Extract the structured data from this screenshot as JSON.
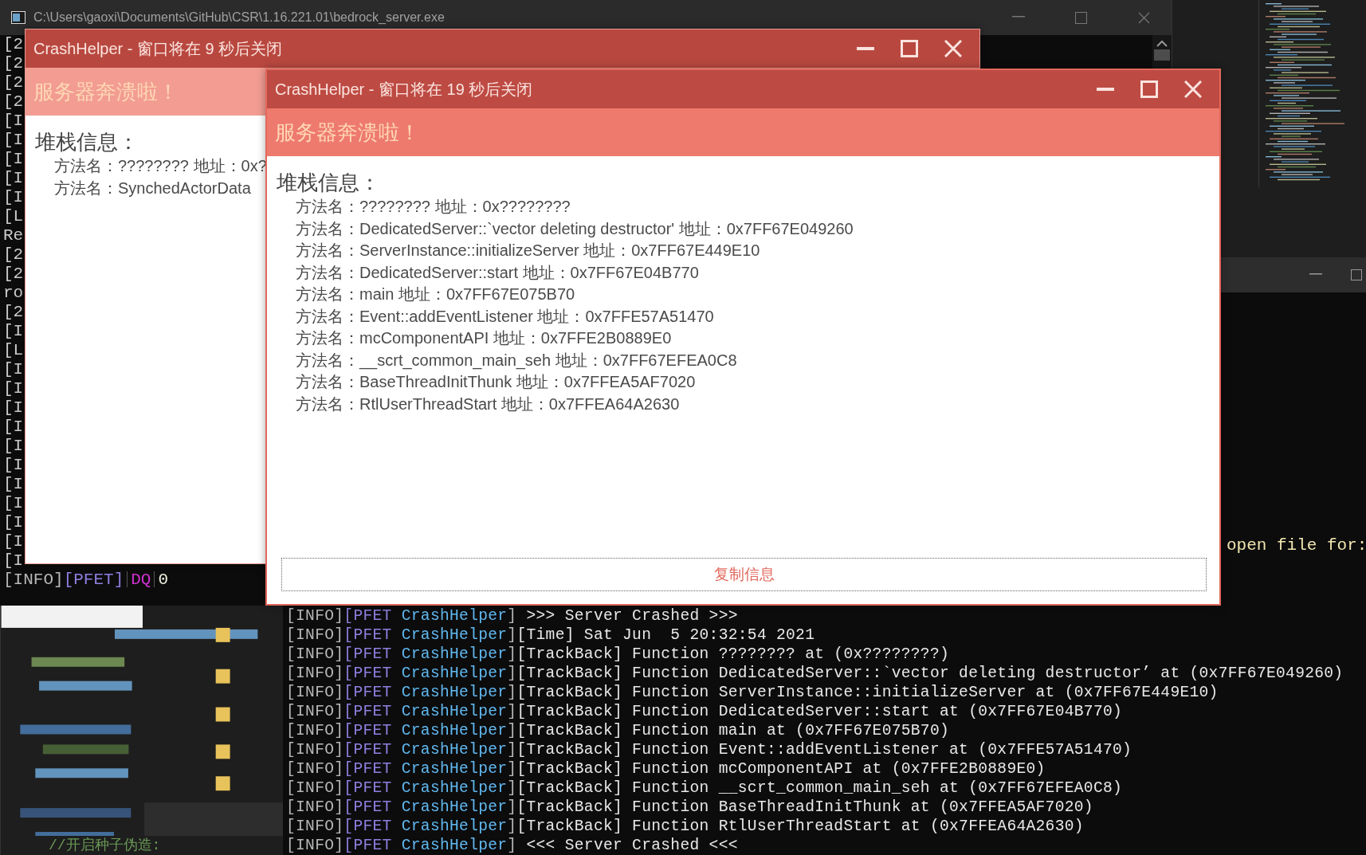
{
  "console_window": {
    "title": "C:\\Users\\gaoxi\\Documents\\GitHub\\CSR\\1.16.221.01\\bedrock_server.exe",
    "lines": [
      "[2",
      "[2",
      "[2",
      "[2",
      "[I",
      "[I",
      "[I",
      "[I",
      "[I",
      "[L",
      "Re",
      "[2",
      "[2",
      "ro",
      "[2",
      "[I",
      "[L",
      "[I",
      "[I",
      "[I",
      "[I",
      "[I",
      "[I",
      "[I",
      "[I",
      "[I",
      "[I",
      "[I"
    ],
    "status_line": {
      "level": "[INFO]",
      "module": "[PFET]",
      "tag": "DQ",
      "value": "0"
    }
  },
  "crash_windows": [
    {
      "title": "CrashHelper - 窗口将在 9 秒后关闭",
      "active": false,
      "header": "服务器奔溃啦！",
      "section_title": "堆栈信息：",
      "frames": [
        "方法名：???????? 地址：0x?",
        "方法名：SynchedActorData"
      ]
    },
    {
      "title": "CrashHelper - 窗口将在 19 秒后关闭",
      "active": true,
      "header": "服务器奔溃啦！",
      "section_title": "堆栈信息：",
      "frames": [
        "方法名：???????? 地址：0x????????",
        "方法名：DedicatedServer::`vector deleting destructor' 地址：0x7FF67E049260",
        "方法名：ServerInstance::initializeServer 地址：0x7FF67E449E10",
        "方法名：DedicatedServer::start 地址：0x7FF67E04B770",
        "方法名：main 地址：0x7FF67E075B70",
        "方法名：Event::addEventListener 地址：0x7FFE57A51470",
        "方法名：mcComponentAPI 地址：0x7FFE2B0889E0",
        "方法名：__scrt_common_main_seh 地址：0x7FF67EFEA0C8",
        "方法名：BaseThreadInitThunk 地址：0x7FFEA5AF7020",
        "方法名：RtlUserThreadStart 地址：0x7FFEA64A2630"
      ],
      "copy_button": "复制信息"
    }
  ],
  "log_console": {
    "partial_line": "open file for:",
    "lines": [
      {
        "level": "[INFO]",
        "module": "[PFET",
        "source": "CrashHelper",
        "close": "]",
        "message": " >>> Server Crashed >>>"
      },
      {
        "level": "[INFO]",
        "module": "[PFET",
        "source": "CrashHelper",
        "close": "]",
        "message": "[Time] Sat Jun  5 20:32:54 2021"
      },
      {
        "level": "[INFO]",
        "module": "[PFET",
        "source": "CrashHelper",
        "close": "]",
        "message": "[TrackBack] Function ???????? at (0x????????)"
      },
      {
        "level": "[INFO]",
        "module": "[PFET",
        "source": "CrashHelper",
        "close": "]",
        "message": "[TrackBack] Function DedicatedServer::`vector deleting destructor’ at (0x7FF67E049260)"
      },
      {
        "level": "[INFO]",
        "module": "[PFET",
        "source": "CrashHelper",
        "close": "]",
        "message": "[TrackBack] Function ServerInstance::initializeServer at (0x7FF67E449E10)"
      },
      {
        "level": "[INFO]",
        "module": "[PFET",
        "source": "CrashHelper",
        "close": "]",
        "message": "[TrackBack] Function DedicatedServer::start at (0x7FF67E04B770)"
      },
      {
        "level": "[INFO]",
        "module": "[PFET",
        "source": "CrashHelper",
        "close": "]",
        "message": "[TrackBack] Function main at (0x7FF67E075B70)"
      },
      {
        "level": "[INFO]",
        "module": "[PFET",
        "source": "CrashHelper",
        "close": "]",
        "message": "[TrackBack] Function Event::addEventListener at (0x7FFE57A51470)"
      },
      {
        "level": "[INFO]",
        "module": "[PFET",
        "source": "CrashHelper",
        "close": "]",
        "message": "[TrackBack] Function mcComponentAPI at (0x7FFE2B0889E0)"
      },
      {
        "level": "[INFO]",
        "module": "[PFET",
        "source": "CrashHelper",
        "close": "]",
        "message": "[TrackBack] Function __scrt_common_main_seh at (0x7FF67EFEA0C8)"
      },
      {
        "level": "[INFO]",
        "module": "[PFET",
        "source": "CrashHelper",
        "close": "]",
        "message": "[TrackBack] Function BaseThreadInitThunk at (0x7FFEA5AF7020)"
      },
      {
        "level": "[INFO]",
        "module": "[PFET",
        "source": "CrashHelper",
        "close": "]",
        "message": "[TrackBack] Function RtlUserThreadStart at (0x7FFEA64A2630)"
      },
      {
        "level": "[INFO]",
        "module": "[PFET",
        "source": "CrashHelper",
        "close": "]",
        "message": " <<< Server Crashed <<<"
      }
    ]
  },
  "code_editor": {
    "comment": "//开启种子伪造:"
  }
}
